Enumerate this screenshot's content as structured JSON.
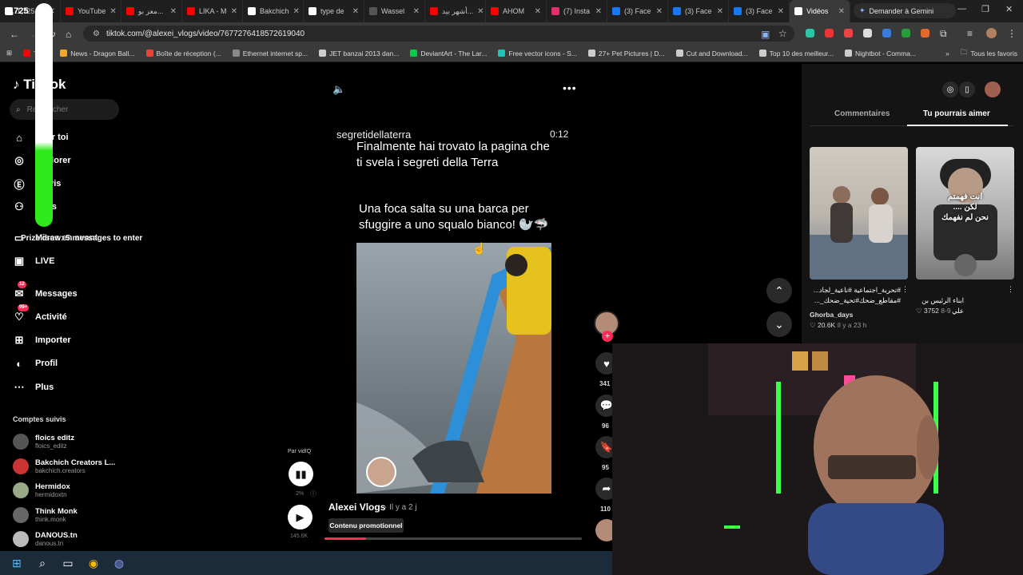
{
  "browser": {
    "tabs": [
      {
        "label": "1,725",
        "color": "#ffffff"
      },
      {
        "label": "YouTube",
        "color": "#ff0000"
      },
      {
        "label": "معز بو...",
        "color": "#ff0000"
      },
      {
        "label": "LIKA - M",
        "color": "#ff0000"
      },
      {
        "label": "Bakchich",
        "color": "#ffffff"
      },
      {
        "label": "type de",
        "color": "#ffffff"
      },
      {
        "label": "Wassel",
        "color": "#555555"
      },
      {
        "label": "أشهر بيد...",
        "color": "#ff0000"
      },
      {
        "label": "AHOM",
        "color": "#ff0000"
      },
      {
        "label": "(7) Insta",
        "color": "#e1306c"
      },
      {
        "label": "(3) Face",
        "color": "#1877f2"
      },
      {
        "label": "(3) Face",
        "color": "#1877f2"
      },
      {
        "label": "(3) Face",
        "color": "#1877f2"
      },
      {
        "label": "Vidéos",
        "color": "#ffffff",
        "active": true
      }
    ],
    "gemini_label": "Demander à Gemini",
    "url": "tiktok.com/@alexei_vlogs/video/7677276418572619040",
    "bookmarks": [
      {
        "label": "Tube",
        "color": "#ff0000"
      },
      {
        "label": "News - Dragon Ball...",
        "color": "#f5a623"
      },
      {
        "label": "Boîte de réception (...",
        "color": "#ea4335"
      },
      {
        "label": "Ethernet internet sp...",
        "color": "#888888"
      },
      {
        "label": "JET banzai 2013 dan...",
        "color": "#cccccc"
      },
      {
        "label": "DeviantArt - The Lar...",
        "color": "#05cc47"
      },
      {
        "label": "Free vector icons - S...",
        "color": "#22c3b7"
      },
      {
        "label": "27+ Pet Pictures | D...",
        "color": "#cccccc"
      },
      {
        "label": "Cut and Download...",
        "color": "#cccccc"
      },
      {
        "label": "Top 10 des meilleur...",
        "color": "#cccccc"
      },
      {
        "label": "Nightbot - Comma...",
        "color": "#cccccc"
      }
    ],
    "all_bookmarks": "Tous les favoris"
  },
  "overlay": {
    "counter": "1,725",
    "prize_text": "Prize draw: 5 messages to enter",
    "bar_level": 0.34
  },
  "sidebar": {
    "logo": "TikTok",
    "search_placeholder": "Rechercher",
    "nav": [
      {
        "label": "Pour toi",
        "icon": "home-icon"
      },
      {
        "label": "Explorer",
        "icon": "compass-icon"
      },
      {
        "label": "Suivis",
        "icon": "following-icon"
      },
      {
        "label": "Amis",
        "icon": "friends-icon"
      },
      {
        "label": "Mises en avant",
        "icon": "promote-icon"
      },
      {
        "label": "LIVE",
        "icon": "live-icon"
      },
      {
        "label": "Messages",
        "icon": "messages-icon",
        "badge": "12"
      },
      {
        "label": "Activité",
        "icon": "activity-icon",
        "badge": "99+"
      },
      {
        "label": "Importer",
        "icon": "upload-icon"
      },
      {
        "label": "Profil",
        "icon": "profile-icon"
      },
      {
        "label": "Plus",
        "icon": "more-icon"
      }
    ],
    "following_header": "Comptes suivis",
    "accounts": [
      {
        "name": "floics editz",
        "user": "floics_editz"
      },
      {
        "name": "Bakchich Creators L...",
        "user": "bakchich.creators"
      },
      {
        "name": "Hermidox",
        "user": "hermidoxtn"
      },
      {
        "name": "Think Monk",
        "user": "think.monk"
      },
      {
        "name": "DANOUS.tn",
        "user": "danous.tn"
      }
    ]
  },
  "video": {
    "account": "segretidellaterra",
    "time": "0:12",
    "caption1_line1": "Finalmente hai trovato la pagina che",
    "caption1_line2": "ti svela i segreti della Terra",
    "caption2_line1": "Una foca salta su una barca per",
    "caption2_line2": "sfuggire a uno squalo bianco! 🦭🦈",
    "creator": "Alexei Vlogs",
    "posted": "· Il y a 2 j",
    "promo": "Contenu promotionnel",
    "progress": 0.16
  },
  "vidiq": {
    "label": "Par vidIQ",
    "percent": "2%",
    "views": "145.6K"
  },
  "actions": {
    "likes": "341",
    "comments": "96",
    "saves": "95",
    "shares": "110"
  },
  "right_panel": {
    "tab_comments": "Commentaires",
    "tab_like": "Tu pourrais aimer",
    "videos": [
      {
        "desc": "#تحربة_اجتماعية #ناعية_لجاد... #مقاطع_ضحك#تحية_ضحك_...",
        "author": "Ghorba_days",
        "likes": "20.6K",
        "time": "Il y a 23 h"
      },
      {
        "desc": "ابناء الرئيس بن علي",
        "author": "",
        "likes": "3752",
        "time": "8-9"
      }
    ],
    "thumb2_text_line1": "انت فهمتم",
    "thumb2_text_line2": "لكن ....",
    "thumb2_text_line3": "نحن لم نفهمك"
  }
}
